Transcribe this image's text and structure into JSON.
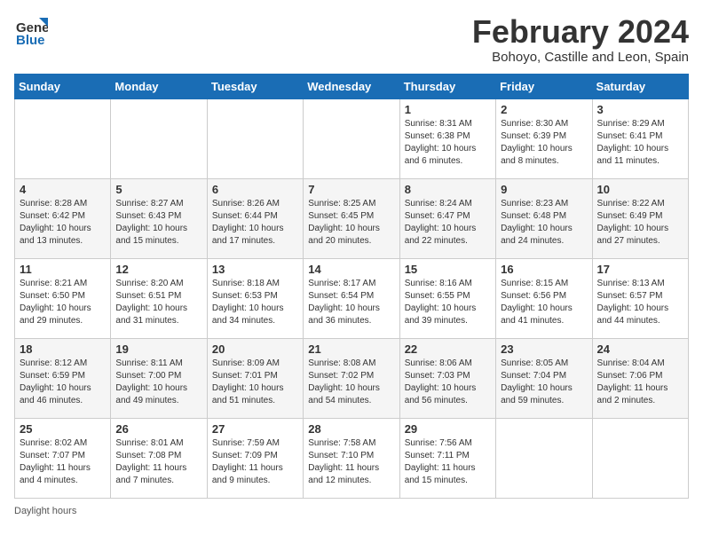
{
  "header": {
    "logo_general": "General",
    "logo_blue": "Blue",
    "month_title": "February 2024",
    "subtitle": "Bohoyo, Castille and Leon, Spain"
  },
  "days_of_week": [
    "Sunday",
    "Monday",
    "Tuesday",
    "Wednesday",
    "Thursday",
    "Friday",
    "Saturday"
  ],
  "weeks": [
    [
      {
        "day": "",
        "info": ""
      },
      {
        "day": "",
        "info": ""
      },
      {
        "day": "",
        "info": ""
      },
      {
        "day": "",
        "info": ""
      },
      {
        "day": "1",
        "info": "Sunrise: 8:31 AM\nSunset: 6:38 PM\nDaylight: 10 hours\nand 6 minutes."
      },
      {
        "day": "2",
        "info": "Sunrise: 8:30 AM\nSunset: 6:39 PM\nDaylight: 10 hours\nand 8 minutes."
      },
      {
        "day": "3",
        "info": "Sunrise: 8:29 AM\nSunset: 6:41 PM\nDaylight: 10 hours\nand 11 minutes."
      }
    ],
    [
      {
        "day": "4",
        "info": "Sunrise: 8:28 AM\nSunset: 6:42 PM\nDaylight: 10 hours\nand 13 minutes."
      },
      {
        "day": "5",
        "info": "Sunrise: 8:27 AM\nSunset: 6:43 PM\nDaylight: 10 hours\nand 15 minutes."
      },
      {
        "day": "6",
        "info": "Sunrise: 8:26 AM\nSunset: 6:44 PM\nDaylight: 10 hours\nand 17 minutes."
      },
      {
        "day": "7",
        "info": "Sunrise: 8:25 AM\nSunset: 6:45 PM\nDaylight: 10 hours\nand 20 minutes."
      },
      {
        "day": "8",
        "info": "Sunrise: 8:24 AM\nSunset: 6:47 PM\nDaylight: 10 hours\nand 22 minutes."
      },
      {
        "day": "9",
        "info": "Sunrise: 8:23 AM\nSunset: 6:48 PM\nDaylight: 10 hours\nand 24 minutes."
      },
      {
        "day": "10",
        "info": "Sunrise: 8:22 AM\nSunset: 6:49 PM\nDaylight: 10 hours\nand 27 minutes."
      }
    ],
    [
      {
        "day": "11",
        "info": "Sunrise: 8:21 AM\nSunset: 6:50 PM\nDaylight: 10 hours\nand 29 minutes."
      },
      {
        "day": "12",
        "info": "Sunrise: 8:20 AM\nSunset: 6:51 PM\nDaylight: 10 hours\nand 31 minutes."
      },
      {
        "day": "13",
        "info": "Sunrise: 8:18 AM\nSunset: 6:53 PM\nDaylight: 10 hours\nand 34 minutes."
      },
      {
        "day": "14",
        "info": "Sunrise: 8:17 AM\nSunset: 6:54 PM\nDaylight: 10 hours\nand 36 minutes."
      },
      {
        "day": "15",
        "info": "Sunrise: 8:16 AM\nSunset: 6:55 PM\nDaylight: 10 hours\nand 39 minutes."
      },
      {
        "day": "16",
        "info": "Sunrise: 8:15 AM\nSunset: 6:56 PM\nDaylight: 10 hours\nand 41 minutes."
      },
      {
        "day": "17",
        "info": "Sunrise: 8:13 AM\nSunset: 6:57 PM\nDaylight: 10 hours\nand 44 minutes."
      }
    ],
    [
      {
        "day": "18",
        "info": "Sunrise: 8:12 AM\nSunset: 6:59 PM\nDaylight: 10 hours\nand 46 minutes."
      },
      {
        "day": "19",
        "info": "Sunrise: 8:11 AM\nSunset: 7:00 PM\nDaylight: 10 hours\nand 49 minutes."
      },
      {
        "day": "20",
        "info": "Sunrise: 8:09 AM\nSunset: 7:01 PM\nDaylight: 10 hours\nand 51 minutes."
      },
      {
        "day": "21",
        "info": "Sunrise: 8:08 AM\nSunset: 7:02 PM\nDaylight: 10 hours\nand 54 minutes."
      },
      {
        "day": "22",
        "info": "Sunrise: 8:06 AM\nSunset: 7:03 PM\nDaylight: 10 hours\nand 56 minutes."
      },
      {
        "day": "23",
        "info": "Sunrise: 8:05 AM\nSunset: 7:04 PM\nDaylight: 10 hours\nand 59 minutes."
      },
      {
        "day": "24",
        "info": "Sunrise: 8:04 AM\nSunset: 7:06 PM\nDaylight: 11 hours\nand 2 minutes."
      }
    ],
    [
      {
        "day": "25",
        "info": "Sunrise: 8:02 AM\nSunset: 7:07 PM\nDaylight: 11 hours\nand 4 minutes."
      },
      {
        "day": "26",
        "info": "Sunrise: 8:01 AM\nSunset: 7:08 PM\nDaylight: 11 hours\nand 7 minutes."
      },
      {
        "day": "27",
        "info": "Sunrise: 7:59 AM\nSunset: 7:09 PM\nDaylight: 11 hours\nand 9 minutes."
      },
      {
        "day": "28",
        "info": "Sunrise: 7:58 AM\nSunset: 7:10 PM\nDaylight: 11 hours\nand 12 minutes."
      },
      {
        "day": "29",
        "info": "Sunrise: 7:56 AM\nSunset: 7:11 PM\nDaylight: 11 hours\nand 15 minutes."
      },
      {
        "day": "",
        "info": ""
      },
      {
        "day": "",
        "info": ""
      }
    ]
  ],
  "footer": {
    "daylight_label": "Daylight hours"
  }
}
